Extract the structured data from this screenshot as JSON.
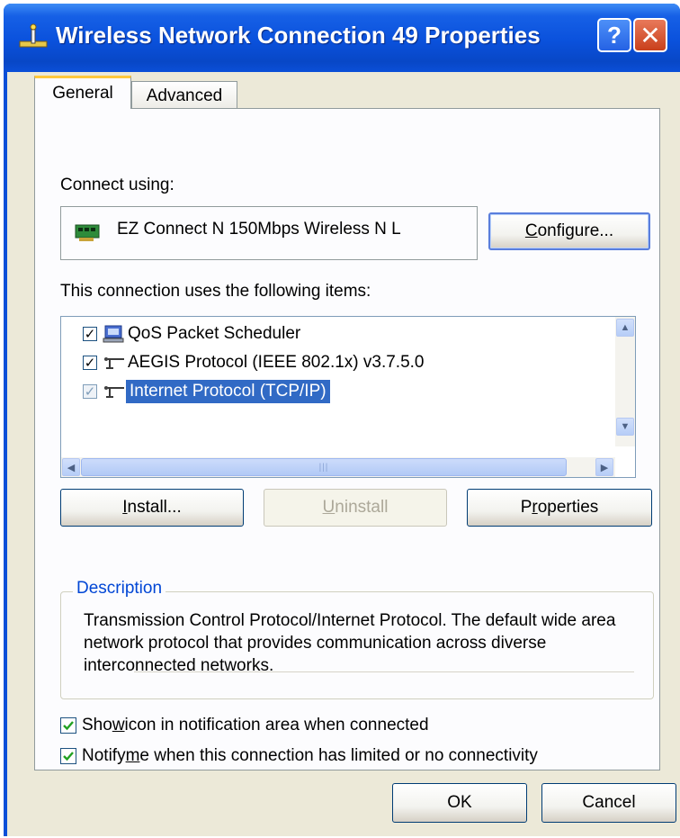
{
  "window": {
    "title": "Wireless Network Connection 49 Properties",
    "help_button": "?",
    "close_button": "✕"
  },
  "tabs": [
    {
      "label": "General",
      "active": true
    },
    {
      "label": "Advanced",
      "active": false
    }
  ],
  "general": {
    "connect_using_label": "Connect using:",
    "adapter_name": "EZ Connect N 150Mbps Wireless N L",
    "configure_button": {
      "before": "",
      "accel": "C",
      "after": "onfigure..."
    },
    "items_label": "This connection uses the following items:",
    "items": [
      {
        "label": "QoS Packet Scheduler",
        "checked": true,
        "selected": false,
        "icon": "scheduler-icon"
      },
      {
        "label": "AEGIS Protocol (IEEE 802.1x) v3.7.5.0",
        "checked": true,
        "selected": false,
        "icon": "protocol-icon"
      },
      {
        "label": "Internet Protocol (TCP/IP)",
        "checked": true,
        "selected": true,
        "icon": "protocol-icon"
      }
    ],
    "install_button": {
      "before": "",
      "accel": "I",
      "after": "nstall..."
    },
    "uninstall_button": {
      "before": "",
      "accel": "U",
      "after": "ninstall"
    },
    "properties_button": {
      "before": "P",
      "accel": "r",
      "after": "operties"
    },
    "description_legend": "Description",
    "description_text": "Transmission Control Protocol/Internet Protocol. The default wide area network protocol that provides communication across diverse interconnected networks.",
    "show_icon_option": {
      "before": "Sho",
      "accel": "w",
      "after": " icon in notification area when connected",
      "checked": true
    },
    "notify_option": {
      "before": "Notify ",
      "accel": "m",
      "after": "e when this connection has limited or no connectivity",
      "checked": true
    }
  },
  "footer": {
    "ok_button": "OK",
    "cancel_button": "Cancel"
  },
  "colors": {
    "titlebar": "#0b4fd8",
    "face": "#ece9d8",
    "selection": "#316ac5",
    "group_legend": "#0046d5"
  }
}
